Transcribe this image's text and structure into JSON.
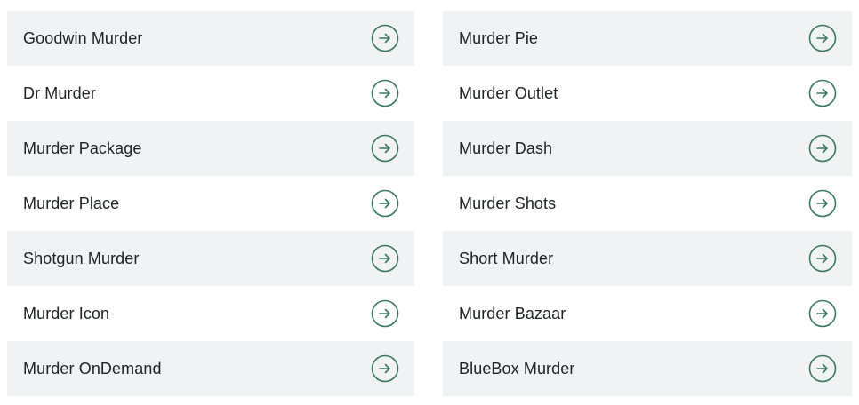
{
  "colors": {
    "shaded_row": "#f1f2f4",
    "accent": "#3a7a5c",
    "text": "#212326"
  },
  "left_column": [
    {
      "label": "Goodwin Murder",
      "icon": "arrow-right-circle-icon"
    },
    {
      "label": "Dr Murder",
      "icon": "arrow-right-circle-icon"
    },
    {
      "label": "Murder Package",
      "icon": "arrow-right-circle-icon"
    },
    {
      "label": "Murder Place",
      "icon": "arrow-right-circle-icon"
    },
    {
      "label": "Shotgun Murder",
      "icon": "arrow-right-circle-icon"
    },
    {
      "label": "Murder Icon",
      "icon": "arrow-right-circle-icon"
    },
    {
      "label": "Murder OnDemand",
      "icon": "arrow-right-circle-icon"
    }
  ],
  "right_column": [
    {
      "label": "Murder Pie",
      "icon": "arrow-right-circle-icon"
    },
    {
      "label": "Murder Outlet",
      "icon": "arrow-right-circle-icon"
    },
    {
      "label": "Murder Dash",
      "icon": "arrow-right-circle-icon"
    },
    {
      "label": "Murder Shots",
      "icon": "arrow-right-circle-icon"
    },
    {
      "label": "Short Murder",
      "icon": "arrow-right-circle-icon"
    },
    {
      "label": "Murder Bazaar",
      "icon": "arrow-right-circle-icon"
    },
    {
      "label": "BlueBox Murder",
      "icon": "arrow-right-circle-icon"
    }
  ]
}
